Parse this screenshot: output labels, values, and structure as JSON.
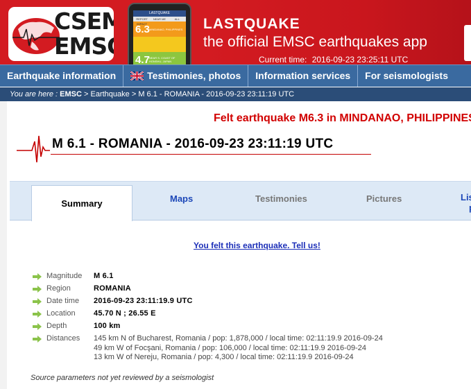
{
  "banner": {
    "logo_line1": "CSEM",
    "logo_line2": "EMSC",
    "app_title": "LASTQUAKE",
    "app_subtitle": "the official EMSC earthquakes app",
    "current_time_label": "Current time:",
    "current_time_value": "2016-09-23 23:25:11 UTC",
    "phone": {
      "header": "LASTQUAKE",
      "tabs": [
        "REPORT IMPACT",
        "NEAR ME",
        "ALL"
      ],
      "rows": [
        {
          "mag": "6.3",
          "label": "MINDANAO, PHILIPPINES"
        },
        {
          "mag": "",
          "label": ""
        },
        {
          "mag": "4.7",
          "label": "NEAR S. COAST OF HONSHU, JAPAN"
        }
      ]
    }
  },
  "nav": {
    "items": [
      {
        "label": "Earthquake information"
      },
      {
        "label": "Testimonies, photos",
        "icon": "uk-flag-icon"
      },
      {
        "label": "Information services"
      },
      {
        "label": "For seismologists"
      }
    ]
  },
  "breadcrumb": {
    "prefix": "You are here :",
    "home": "EMSC",
    "sep1": " > ",
    "section": "Earthquake",
    "sep2": " > ",
    "current": "M 6.1 - ROMANIA - 2016-09-23 23:11:19 UTC"
  },
  "felt_alert": "Felt earthquake M6.3 in MINDANAO, PHILIPPINES",
  "event_title": "M 6.1 - ROMANIA - 2016-09-23 23:11:19 UTC",
  "tabs": {
    "summary": "Summary",
    "maps": "Maps",
    "testimonies": "Testimonies",
    "pictures": "Pictures",
    "more_line1": "Lis",
    "more_line2": "p"
  },
  "felt_link": "You felt this earthquake. Tell us!",
  "details": {
    "magnitude": {
      "label": "Magnitude",
      "value": "M 6.1"
    },
    "region": {
      "label": "Region",
      "value": "ROMANIA"
    },
    "datetime": {
      "label": "Date time",
      "value": "2016-09-23 23:11:19.9 UTC"
    },
    "location": {
      "label": "Location",
      "value": "45.70 N ; 26.55 E"
    },
    "depth": {
      "label": "Depth",
      "value": "100 km"
    },
    "distances": {
      "label": "Distances",
      "lines": [
        "145 km N of Bucharest, Romania / pop: 1,878,000 / local time: 02:11:19.9 2016-09-24",
        "49 km W of Focşani, Romania / pop: 106,000 / local time: 02:11:19.9 2016-09-24",
        "13 km W of Nereju, Romania / pop: 4,300 / local time: 02:11:19.9 2016-09-24"
      ]
    }
  },
  "source_note": "Source parameters not yet reviewed by a seismologist",
  "colors": {
    "banner_red": "#d31b21",
    "nav_blue": "#3a6aa0",
    "breadcrumb_blue": "#2b4d78",
    "alert_red": "#d10000",
    "link_blue": "#1c2fb8",
    "arrow_green": "#8bc34a"
  }
}
